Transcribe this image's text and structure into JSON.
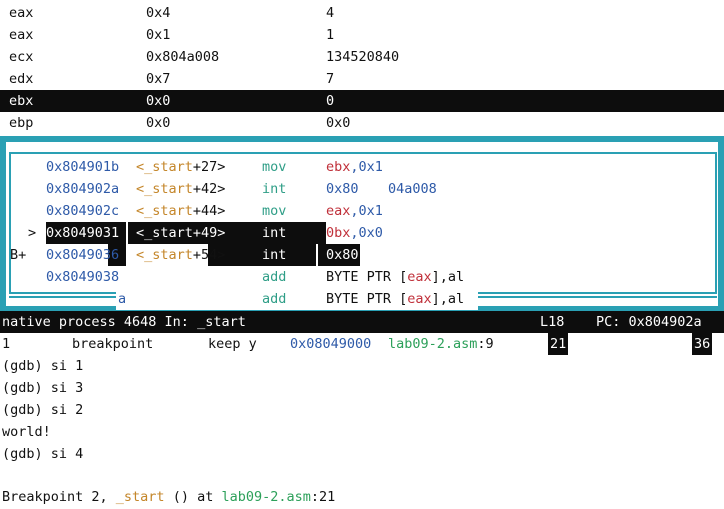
{
  "registers": [
    {
      "name": "eax",
      "hex": "0x4",
      "dec": "4"
    },
    {
      "name": "eax",
      "hex": "0x1",
      "dec": "1"
    },
    {
      "name": "ecx",
      "hex": "0x804a008",
      "dec": "134520840"
    },
    {
      "name": "edx",
      "hex": "0x7",
      "dec": "7"
    },
    {
      "name": "ebx",
      "hex": "0x0",
      "dec": "0"
    },
    {
      "name": "ebp",
      "hex": "0x0",
      "dec": "0x0"
    }
  ],
  "asm": [
    {
      "marker": "",
      "addr": "0x804901b",
      "sym": "<_start",
      "off": "+27>",
      "op": "mov",
      "arg1": "ebx",
      "arg2": ",0x1"
    },
    {
      "marker": "",
      "addr": "0x804902a",
      "sym": "<_start",
      "off": "+42>",
      "op": "int",
      "arg1": "0x80",
      "arg2": "04a008"
    },
    {
      "marker": "",
      "addr": "0x804902c",
      "sym": "<_start",
      "off": "+44>",
      "op": "mov",
      "arg1": "eax",
      "arg2": ",0x1"
    },
    {
      "marker": ">",
      "addr_a": "0x8049031",
      "addr": "0x8049031",
      "sym": "<_start",
      "off": "+49>",
      "op": "int",
      "arg1": "0bx",
      "arg2": ",0x0"
    },
    {
      "marker": "B+",
      "addr": "0x8049036",
      "sym": "<_start",
      "off": "+54>",
      "op": "int",
      "arg1": "0x80",
      "arg2": ""
    },
    {
      "marker": "",
      "addr": "0x8049038",
      "sym": "",
      "off": "",
      "op": "add",
      "arg1": "BYTE PTR [",
      "arg_reg": "eax",
      "arg2": "],al"
    },
    {
      "marker": "",
      "addr": "a",
      "sym": "",
      "off": "",
      "op": "add",
      "arg1": "BYTE PTR [",
      "arg_reg": "eax",
      "arg2": "],al"
    }
  ],
  "status": {
    "process": "native process 4648 In: _start",
    "line": "L18",
    "pc": "PC: 0x804902a"
  },
  "breakpoint": {
    "num": "1",
    "type": "breakpoint",
    "disp": "keep y",
    "addr": "0x08049000",
    "file": "lab09-2.asm",
    "line": ":9",
    "hit_a": "21",
    "hit_b": "36"
  },
  "console": [
    "(gdb) si 1",
    "(gdb) si 3",
    "(gdb) si 2",
    "world!",
    "(gdb) si 4",
    ""
  ],
  "final": {
    "prefix": "Breakpoint 2, ",
    "func": "_start",
    "mid": " () at ",
    "file": "lab09-2.asm",
    "line": ":21"
  }
}
